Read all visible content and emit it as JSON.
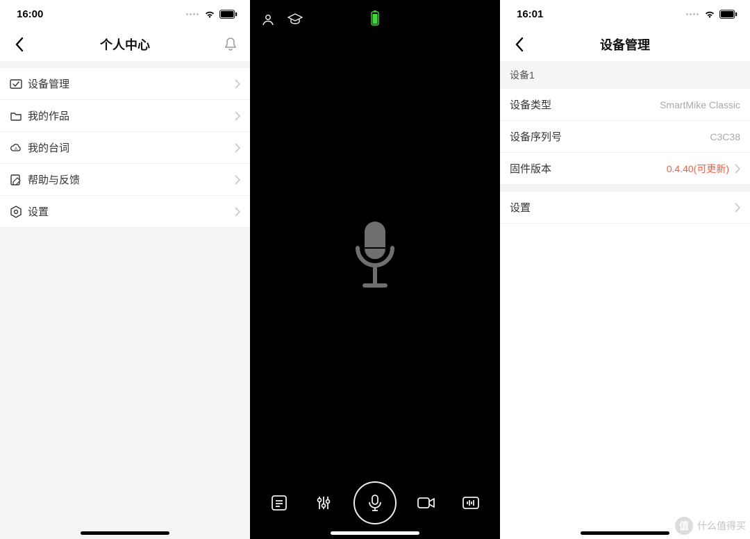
{
  "panel1": {
    "status": {
      "time": "16:00"
    },
    "nav": {
      "title": "个人中心"
    },
    "menu": [
      {
        "icon": "device-check-icon",
        "label": "设备管理"
      },
      {
        "icon": "folder-icon",
        "label": "我的作品"
      },
      {
        "icon": "cloud-a-icon",
        "label": "我的台词"
      },
      {
        "icon": "edit-doc-icon",
        "label": "帮助与反馈"
      },
      {
        "icon": "gear-hex-icon",
        "label": "设置"
      }
    ]
  },
  "panel2": {
    "top_icons": [
      "profile",
      "graduation"
    ],
    "bottom": [
      "subtitle",
      "levels",
      "record",
      "camera",
      "wave"
    ]
  },
  "panel3": {
    "status": {
      "time": "16:01"
    },
    "nav": {
      "title": "设备管理"
    },
    "section": "设备1",
    "rows": {
      "type_label": "设备类型",
      "type_value": "SmartMike Classic",
      "serial_label": "设备序列号",
      "serial_value": "C3C38",
      "firmware_label": "固件版本",
      "firmware_value": "0.4.40(可更新)",
      "settings_label": "设置"
    }
  },
  "watermark": {
    "badge": "值",
    "text": "什么值得买"
  }
}
